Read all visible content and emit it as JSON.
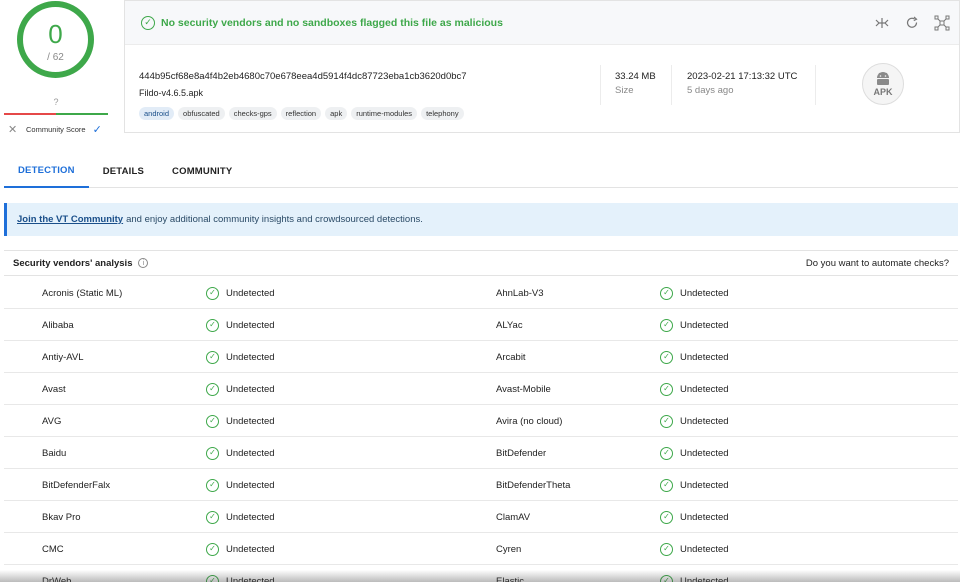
{
  "score": {
    "detections": "0",
    "total": "/ 62"
  },
  "community_score": {
    "value": "?",
    "label": "Community Score"
  },
  "banner": {
    "message": "No security vendors and no sandboxes flagged this file as malicious"
  },
  "file": {
    "hash": "444b95cf68e8a4f4b2eb4680c70e678eea4d5914f4dc87723eba1cb3620d0bc7",
    "name": "Fildo-v4.6.5.apk",
    "tags": [
      "android",
      "obfuscated",
      "checks-gps",
      "reflection",
      "apk",
      "runtime-modules",
      "telephony"
    ],
    "size_value": "33.24 MB",
    "size_label": "Size",
    "date_value": "2023-02-21 17:13:32 UTC",
    "date_label": "5 days ago",
    "type_badge": "APK"
  },
  "tabs": [
    "DETECTION",
    "DETAILS",
    "COMMUNITY"
  ],
  "community_banner": {
    "link": "Join the VT Community",
    "text": "and enjoy additional community insights and crowdsourced detections."
  },
  "analysis": {
    "title": "Security vendors' analysis",
    "automate": "Do you want to automate checks?"
  },
  "vendors": [
    [
      "Acronis (Static ML)",
      "Undetected",
      "AhnLab-V3",
      "Undetected"
    ],
    [
      "Alibaba",
      "Undetected",
      "ALYac",
      "Undetected"
    ],
    [
      "Antiy-AVL",
      "Undetected",
      "Arcabit",
      "Undetected"
    ],
    [
      "Avast",
      "Undetected",
      "Avast-Mobile",
      "Undetected"
    ],
    [
      "AVG",
      "Undetected",
      "Avira (no cloud)",
      "Undetected"
    ],
    [
      "Baidu",
      "Undetected",
      "BitDefender",
      "Undetected"
    ],
    [
      "BitDefenderFalx",
      "Undetected",
      "BitDefenderTheta",
      "Undetected"
    ],
    [
      "Bkav Pro",
      "Undetected",
      "ClamAV",
      "Undetected"
    ],
    [
      "CMC",
      "Undetected",
      "Cyren",
      "Undetected"
    ],
    [
      "DrWeb",
      "Undetected",
      "Elastic",
      "Undetected"
    ]
  ],
  "colors": {
    "clean": "#3ea84a",
    "accent": "#1e6fd9",
    "malicious": "#e54848"
  }
}
